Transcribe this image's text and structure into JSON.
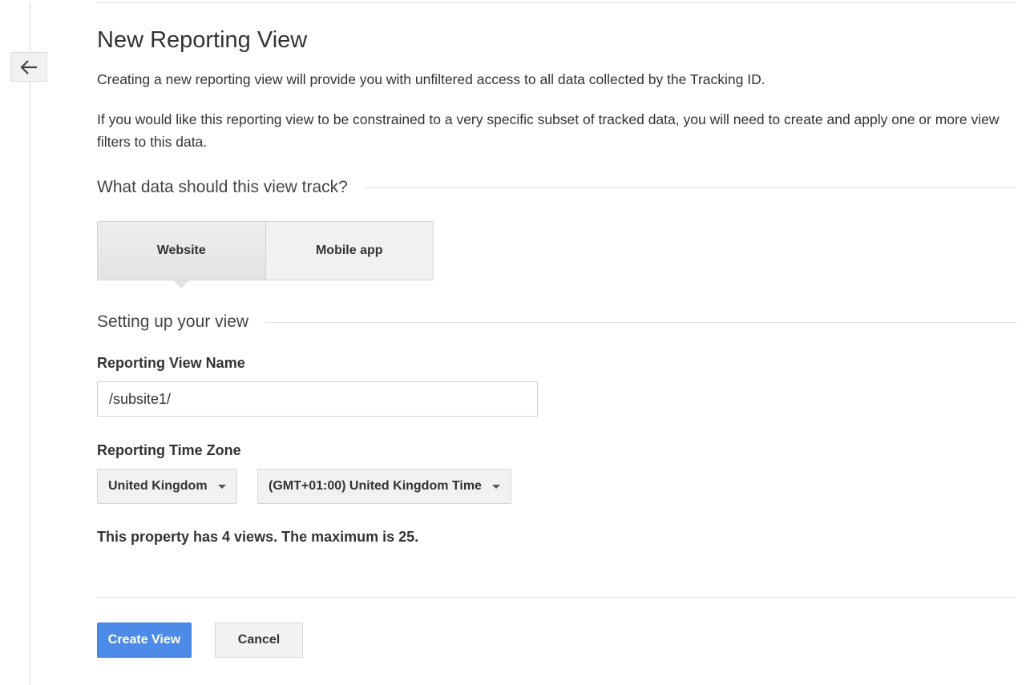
{
  "page": {
    "title": "New Reporting View",
    "intro": "Creating a new reporting view will provide you with unfiltered access to all data collected by the Tracking ID.",
    "filter_note": "If you would like this reporting view to be constrained to a very specific subset of tracked data, you will need to create and apply one or more view filters to this data."
  },
  "back_button": {
    "icon": "arrow-left-icon"
  },
  "track_section": {
    "title": "What data should this view track?",
    "options": [
      {
        "label": "Website",
        "selected": true
      },
      {
        "label": "Mobile app",
        "selected": false
      }
    ]
  },
  "setup_section": {
    "title": "Setting up your view",
    "view_name": {
      "label": "Reporting View Name",
      "value": "/subsite1/"
    },
    "time_zone": {
      "label": "Reporting Time Zone",
      "country": "United Kingdom",
      "zone": "(GMT+01:00) United Kingdom Time"
    },
    "views_info": "This property has 4 views. The maximum is 25."
  },
  "actions": {
    "create_label": "Create View",
    "cancel_label": "Cancel"
  },
  "colors": {
    "primary": "#4d8be9"
  }
}
